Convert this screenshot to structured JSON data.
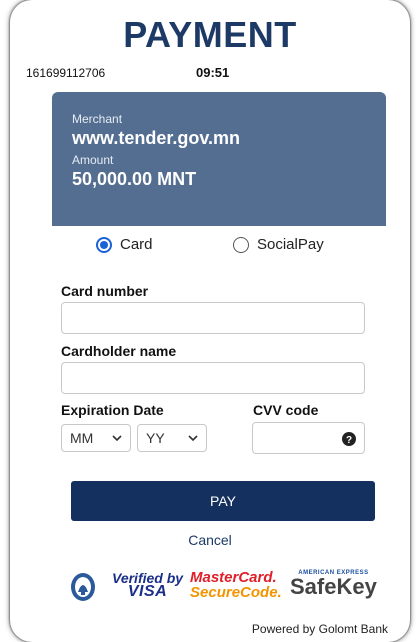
{
  "header": {
    "title": "PAYMENT",
    "transaction_id": "161699112706",
    "timer": "09:51"
  },
  "merchant": {
    "merchant_label": "Merchant",
    "merchant_value": "www.tender.gov.mn",
    "amount_label": "Amount",
    "amount_value": "50,000.00 MNT",
    "panel_color": "#546e91"
  },
  "payment_method": {
    "options": [
      {
        "label": "Card",
        "selected": true
      },
      {
        "label": "SocialPay",
        "selected": false
      }
    ]
  },
  "form": {
    "card_number_label": "Card number",
    "card_number_value": "",
    "cardholder_label": "Cardholder name",
    "cardholder_value": "",
    "expiration_label": "Expiration Date",
    "month_value": "MM",
    "year_value": "YY",
    "cvv_label": "CVV code",
    "cvv_value": ""
  },
  "actions": {
    "pay_label": "PAY",
    "cancel_label": "Cancel",
    "pay_color": "#14305e"
  },
  "logos": {
    "verified_by": "Verified by",
    "visa": "VISA",
    "mastercard": "MasterCard.",
    "securecode": "SecureCode.",
    "amex": "AMERICAN EXPRESS",
    "safekey": "SafeKey"
  },
  "footer": {
    "powered_by": "Powered by Golomt Bank"
  }
}
